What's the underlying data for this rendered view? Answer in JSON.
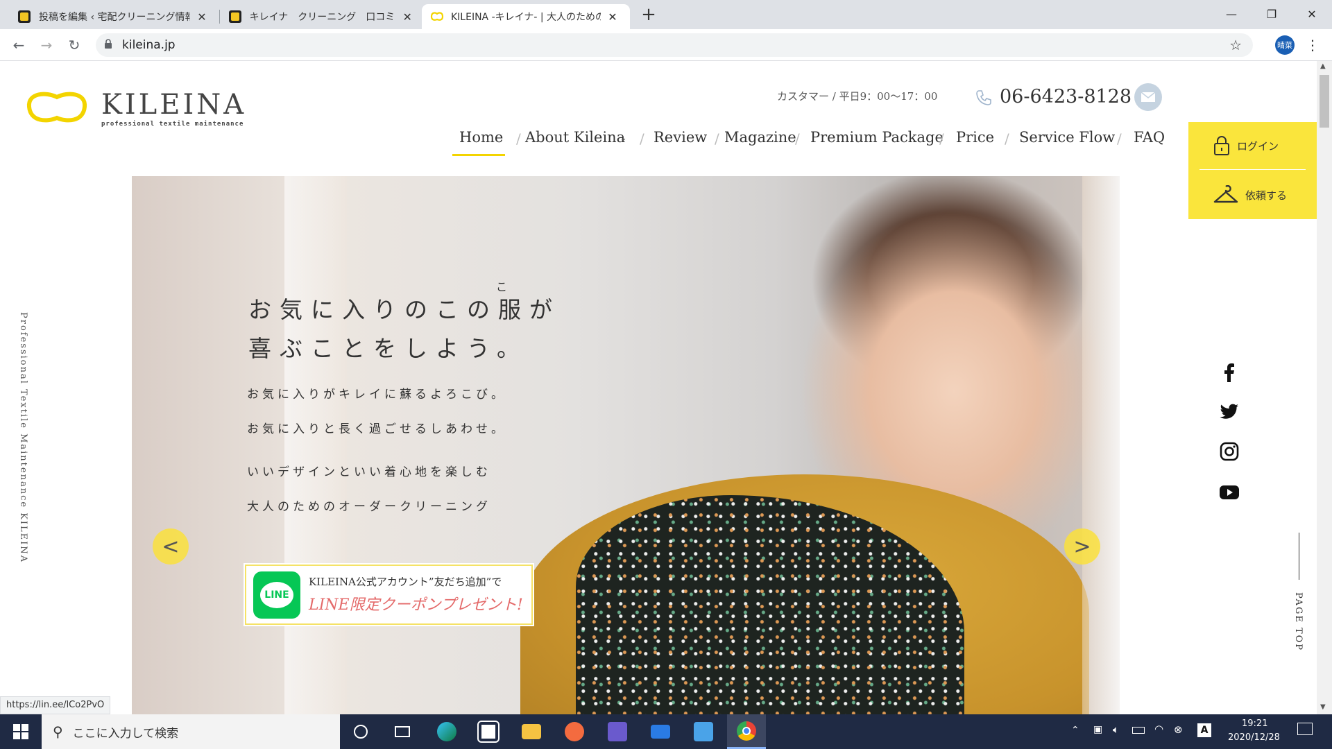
{
  "browser": {
    "tabs": [
      {
        "title": "投稿を編集 ‹ 宅配クリーニング情報館",
        "active": false
      },
      {
        "title": "キレイナ　クリーニング　口コミ | 宅配",
        "active": false
      },
      {
        "title": "KILEINA -キレイナ- | 大人のための",
        "active": true
      }
    ],
    "new_tab": "+",
    "url": "kileina.jp",
    "profile_label": "晴菜",
    "status_url": "https://lin.ee/lCo2PvO"
  },
  "site": {
    "logo_text": "KILEINA",
    "logo_tagline": "professional textile maintenance",
    "hours_label": "カスタマー / 平日9：00～17：00",
    "phone": "06-6423-8128",
    "nav": [
      {
        "label": "Home",
        "active": true
      },
      {
        "label": "About Kileina",
        "dropdown": true
      },
      {
        "label": "Review"
      },
      {
        "label": "Magazine"
      },
      {
        "label": "Premium Package"
      },
      {
        "label": "Price"
      },
      {
        "label": "Service Flow"
      },
      {
        "label": "FAQ"
      }
    ],
    "login_label": "ログイン",
    "request_label": "依頼する",
    "vertical_text": "Professional Textile Maintenance KILEINA",
    "page_top": "PAGE TOP",
    "accent_color": "#fae53c"
  },
  "hero": {
    "ruby": "こ",
    "title_line1": "お気に入りのこの服が",
    "title_line2": "喜ぶことをしよう。",
    "sub1": "お気に入りがキレイに蘇るよろこび。",
    "sub2": "お気に入りと長く過ごせるしあわせ。",
    "sub3": "いいデザインといい着心地を楽しむ",
    "sub4": "大人のためのオーダークリーニング",
    "prev": "<",
    "next": ">",
    "line_banner": {
      "icon_text": "LINE",
      "line1": "KILEINA公式アカウント”友だち追加”で",
      "line2": "LINE限定クーポンプレゼント!"
    }
  },
  "taskbar": {
    "search_placeholder": "ここに入力して検索",
    "time": "19:21",
    "date": "2020/12/28"
  }
}
